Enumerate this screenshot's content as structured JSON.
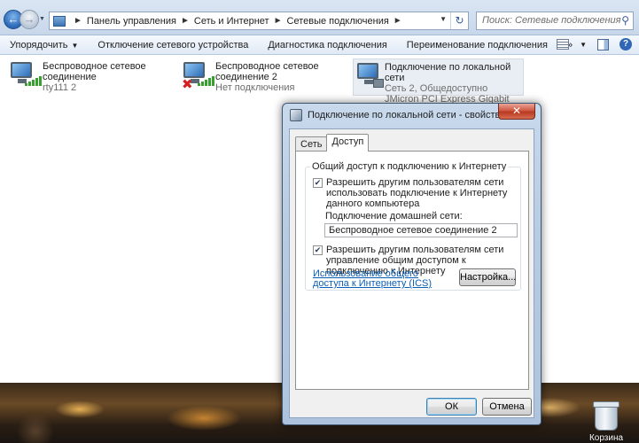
{
  "address": {
    "breadcrumbs": [
      "Панель управления",
      "Сеть и Интернет",
      "Сетевые подключения"
    ],
    "search_placeholder": "Поиск: Сетевые подключения"
  },
  "toolbar": {
    "organize": "Упорядочить",
    "disable": "Отключение сетевого устройства",
    "diagnose": "Диагностика подключения",
    "rename": "Переименование подключения",
    "more": "»"
  },
  "connections": [
    {
      "name_line1": "Беспроводное сетевое",
      "name_line2": "соединение",
      "status": "rty111  2"
    },
    {
      "name_line1": "Беспроводное сетевое",
      "name_line2": "соединение 2",
      "status": "Нет подключения"
    },
    {
      "name_line1": "Подключение по локальной сети",
      "name_line2": "Сеть  2, Общедоступно",
      "status": "JMicron PCI Express Gigabit Ether..."
    }
  ],
  "dialog": {
    "title": "Подключение по локальной сети - свойства",
    "tabs": [
      "Сеть",
      "Доступ"
    ],
    "group_title": "Общий доступ к подключению к Интернету",
    "allow_connect": "Разрешить другим пользователям сети использовать подключение к Интернету данного компьютера",
    "allow_connect_checked": true,
    "home_network_label": "Подключение домашней сети:",
    "home_network_value": "Беспроводное сетевое соединение 2",
    "allow_control": "Разрешить другим пользователям сети управление общим доступом к подключению к Интернету",
    "allow_control_checked": true,
    "ics_link": "Использование общего доступа к Интернету (ICS)",
    "settings_button": "Настройка...",
    "ok_button": "ОК",
    "cancel_button": "Отмена"
  },
  "desktop": {
    "recycle_bin": "Корзина"
  }
}
